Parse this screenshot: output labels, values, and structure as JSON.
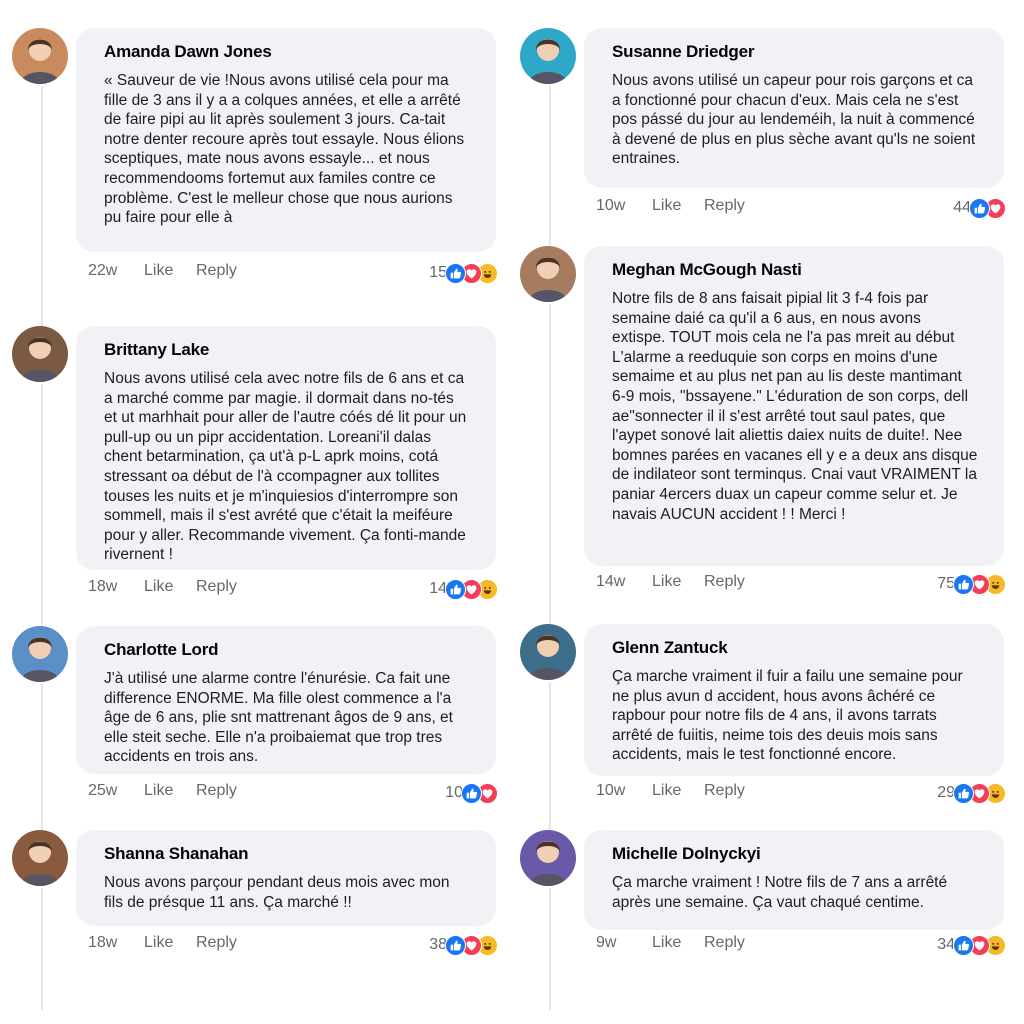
{
  "labels": {
    "like": "Like",
    "reply": "Reply"
  },
  "colors": {
    "like": "#1877f2",
    "love": "#f33e58",
    "haha": "#f7b928",
    "bubble": "#f0f2f5",
    "meta": "#65676b"
  },
  "comments": [
    {
      "author": "Amanda Dawn Jones",
      "text": "« Sauveur de vie !Nous avons utilisé cela pour ma fille de 3 ans il y a a colques années, et elle a arrêté de faire pipi au lit après soulement 3 jours. Ca-tait notre denter recoure après tout essayle. Nous élions sceptiques, mate nous avons essayle... et nous recommendooms fortemut aux familes contre ce problème. C'est le melleur chose que nous aurions pu faire pour elle à",
      "age": "22w",
      "reaction_count": "15",
      "reactions": [
        "like-icon",
        "love-icon",
        "haha-icon"
      ],
      "avatar_color": "#c98a5e"
    },
    {
      "author": "Susanne Driedger",
      "text": "Nous avons utilisé un capeur pour rois garçons et ca a fonctionné pour chacun d'eux. Mais cela ne s'est pos pássé du jour au lendeméih, la nuit à commencé à devené de plus en plus sèche avant qu'ls ne soient entraines.",
      "age": "10w",
      "reaction_count": "44",
      "reactions": [
        "like-icon",
        "love-icon"
      ],
      "avatar_color": "#2fa7c9"
    },
    {
      "author": "Brittany Lake",
      "text": "Nous avons utilisé cela avec notre fils de 6 ans et ca a marché comme par magie. il dormait dans no-tés et ut marhhait pour aller de l'autre cóés dé lit pour un pull-up ou un pipr accidentation. Loreani'il dalas chent betarmination, ça ut'à p-L aprk moins, cotá stressant oa début de l'à ccompagner aux tollites touses les nuits et je m'inquiesios d'interrompre son sommell, mais il s'est avrété que c'était la meiféure pour y aller. Recommande vivement. Ça fonti-mande rivernent !",
      "age": "18w",
      "reaction_count": "14",
      "reactions": [
        "like-icon",
        "love-icon",
        "haha-icon"
      ],
      "avatar_color": "#7a5a44"
    },
    {
      "author": "Meghan McGough Nasti",
      "text": "Notre fils de 8 ans faisait pipial lit 3 f-4 fois par semaine daié ca qu'il a 6 aus, en nous avons extispe. TOUT mois cela ne l'a pas mreit au début L'alarme a reeduquie son corps en moins d'une semaime et au plus net pan au lis deste mantimant 6-9 mois, \"bssayene.\" L'éduration de son corps, dell ae\"sonnecter il il s'est arrêté tout saul pates, que l'aypet sonové lait aliettis daiex nuits de duite!. Nee bomnes parées en vacanes ell y e a deux ans disque de indilateor sont terminqus. Cnai vaut VRAIMENT la paniar 4ercers duax un capeur comme selur et. Je navais AUCUN accident ! ! Merci !",
      "age": "14w",
      "reaction_count": "75",
      "reactions": [
        "like-icon",
        "love-icon",
        "haha-icon"
      ],
      "avatar_color": "#a77b5f"
    },
    {
      "author": "Charlotte Lord",
      "text": "J'à utilisé une alarme contre l'énurésie. Ca fait une difference ENORME. Ma fille olest commence a l'a âge de 6 ans, plie snt mattrenant âgos de 9 ans, et elle steit seche. Elle n'a proibaiemat que trop tres accidents en trois ans.",
      "age": "25w",
      "reaction_count": "10",
      "reactions": [
        "like-icon",
        "love-icon"
      ],
      "avatar_color": "#5b8fc7"
    },
    {
      "author": "Glenn Zantuck",
      "text": "Ça marche vraiment il fuir a failu une semaine pour ne plus avun d accident, hous avons âchéré ce rapbour pour notre fils de 4 ans, il avons tarrats arrêté de fuiitis, neime tois des deuis mois sans accidents, mais le test fonctionné encore.",
      "age": "10w",
      "reaction_count": "29",
      "reactions": [
        "like-icon",
        "love-icon",
        "haha-icon"
      ],
      "avatar_color": "#3d6e8c"
    },
    {
      "author": "Shanna Shanahan",
      "text": "Nous avons parçour pendant deus mois avec mon fils de présque 11 ans. Ça marché !!",
      "age": "18w",
      "reaction_count": "38",
      "reactions": [
        "like-icon",
        "love-icon",
        "haha-icon"
      ],
      "avatar_color": "#8a5a3c"
    },
    {
      "author": "Michelle Dolnyckyi",
      "text": "Ça marche vraiment ! Notre fils de 7 ans a arrêté après une semaine. Ça vaut chaqué centime.",
      "age": "9w",
      "reaction_count": "34",
      "reactions": [
        "like-icon",
        "love-icon",
        "haha-icon"
      ],
      "avatar_color": "#6a58a8"
    }
  ]
}
